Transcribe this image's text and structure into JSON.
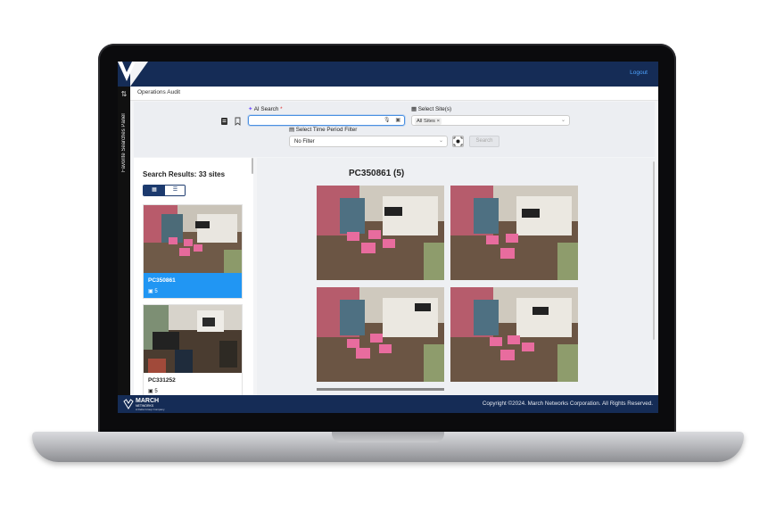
{
  "header": {
    "logout_label": "Logout",
    "bg_color": "#152c56",
    "link_color": "#4ea3ff"
  },
  "side_panel": {
    "label": "Favorite Searches Panel",
    "toggle_icon": "swap-arrows-icon"
  },
  "breadcrumb": {
    "page": "Operations Audit"
  },
  "search": {
    "ai_label": "AI Search",
    "ai_required_mark": "*",
    "ai_value": "",
    "ai_icons": [
      "microphone-icon",
      "image-upload-icon"
    ],
    "left_icons": [
      "saved-searches-icon",
      "bookmark-icon"
    ],
    "sites_label": "Select Site(s)",
    "sites_selected": "All Sites",
    "sites_chip_remove": "×",
    "time_label": "Select Time Period Filter",
    "time_value": "No Filter",
    "search_button": "Search"
  },
  "results": {
    "title": "Search Results: 33 sites",
    "view_modes": [
      "grid-view-icon",
      "list-view-icon"
    ],
    "active_view": "grid",
    "cards": [
      {
        "name": "PC350861",
        "count": "5",
        "selected": true
      },
      {
        "name": "PC331252",
        "count": "5",
        "selected": false
      }
    ]
  },
  "detail": {
    "title": "PC350861 (5)",
    "images_visible": 4
  },
  "footer": {
    "brand_name": "MARCH",
    "brand_sub": "NETWORKS",
    "brand_tag": "A Delta Group Company",
    "copyright": "Copyright ©2024. March Networks Corporation. All Rights Reserved."
  },
  "colors": {
    "accent_selected": "#2196f3",
    "navy": "#152c56",
    "focus_border": "#4a90e2"
  }
}
